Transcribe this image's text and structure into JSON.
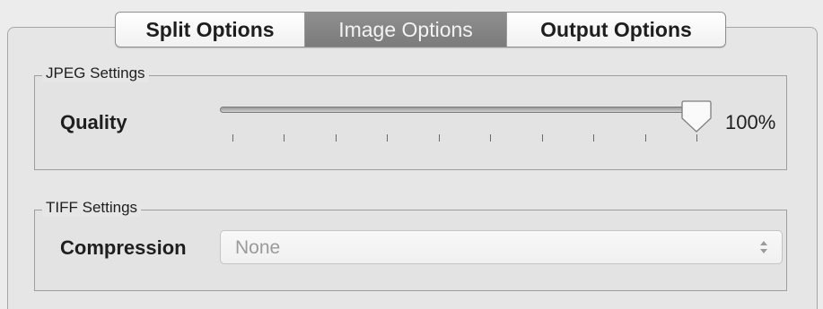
{
  "tabs": [
    {
      "label": "Split Options",
      "selected": false
    },
    {
      "label": "Image Options",
      "selected": true
    },
    {
      "label": "Output Options",
      "selected": false
    }
  ],
  "jpeg": {
    "group_title": "JPEG Settings",
    "quality_label": "Quality",
    "quality_value_text": "100%",
    "quality_level_percent": 100,
    "tick_count": 10
  },
  "tiff": {
    "group_title": "TIFF Settings",
    "compression_label": "Compression",
    "compression_value": "None",
    "compression_enabled": false
  },
  "colors": {
    "selected_tab": "#838383",
    "window_bg": "#ececec"
  },
  "icons": {
    "slider_thumb": "slider-thumb-icon",
    "popup_arrows": "updown-arrows-icon"
  }
}
